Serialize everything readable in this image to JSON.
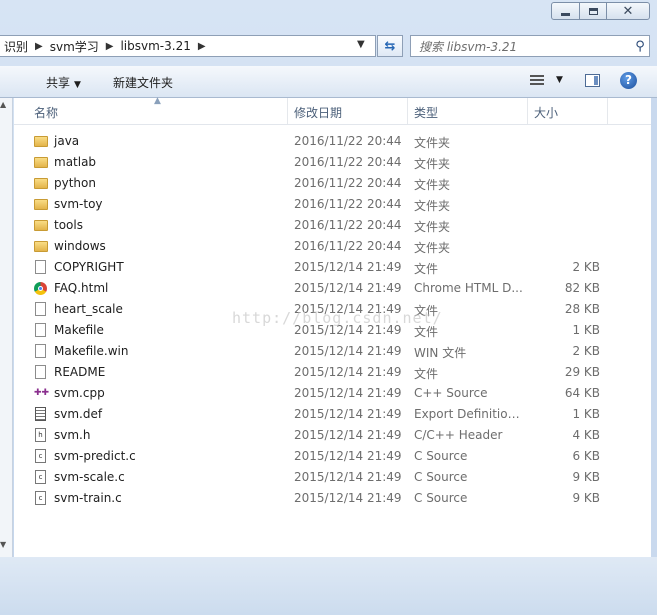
{
  "window": {
    "controls": {
      "minimize": "minimize-icon",
      "maximize": "maximize-icon",
      "close": "close-icon"
    }
  },
  "address": {
    "breadcrumbs": [
      "识别",
      "svm学习",
      "libsvm-3.21"
    ]
  },
  "search": {
    "placeholder": "搜索 libsvm-3.21"
  },
  "toolbar": {
    "share_label": "共享",
    "new_folder_label": "新建文件夹"
  },
  "columns": {
    "name": "名称",
    "date": "修改日期",
    "type": "类型",
    "size": "大小"
  },
  "files": [
    {
      "name": "java",
      "date": "2016/11/22 20:44",
      "type": "文件夹",
      "size": "",
      "icon": "folder-icon"
    },
    {
      "name": "matlab",
      "date": "2016/11/22 20:44",
      "type": "文件夹",
      "size": "",
      "icon": "folder-icon"
    },
    {
      "name": "python",
      "date": "2016/11/22 20:44",
      "type": "文件夹",
      "size": "",
      "icon": "folder-icon"
    },
    {
      "name": "svm-toy",
      "date": "2016/11/22 20:44",
      "type": "文件夹",
      "size": "",
      "icon": "folder-icon"
    },
    {
      "name": "tools",
      "date": "2016/11/22 20:44",
      "type": "文件夹",
      "size": "",
      "icon": "folder-icon"
    },
    {
      "name": "windows",
      "date": "2016/11/22 20:44",
      "type": "文件夹",
      "size": "",
      "icon": "folder-icon"
    },
    {
      "name": "COPYRIGHT",
      "date": "2015/12/14 21:49",
      "type": "文件",
      "size": "2 KB",
      "icon": "file-icon"
    },
    {
      "name": "FAQ.html",
      "date": "2015/12/14 21:49",
      "type": "Chrome HTML D...",
      "size": "82 KB",
      "icon": "chrome-icon"
    },
    {
      "name": "heart_scale",
      "date": "2015/12/14 21:49",
      "type": "文件",
      "size": "28 KB",
      "icon": "file-icon"
    },
    {
      "name": "Makefile",
      "date": "2015/12/14 21:49",
      "type": "文件",
      "size": "1 KB",
      "icon": "file-icon"
    },
    {
      "name": "Makefile.win",
      "date": "2015/12/14 21:49",
      "type": "WIN 文件",
      "size": "2 KB",
      "icon": "file-icon"
    },
    {
      "name": "README",
      "date": "2015/12/14 21:49",
      "type": "文件",
      "size": "29 KB",
      "icon": "file-icon"
    },
    {
      "name": "svm.cpp",
      "date": "2015/12/14 21:49",
      "type": "C++ Source",
      "size": "64 KB",
      "icon": "cpp-icon"
    },
    {
      "name": "svm.def",
      "date": "2015/12/14 21:49",
      "type": "Export Definition...",
      "size": "1 KB",
      "icon": "def-icon"
    },
    {
      "name": "svm.h",
      "date": "2015/12/14 21:49",
      "type": "C/C++ Header",
      "size": "4 KB",
      "icon": "header-icon"
    },
    {
      "name": "svm-predict.c",
      "date": "2015/12/14 21:49",
      "type": "C Source",
      "size": "6 KB",
      "icon": "c-icon"
    },
    {
      "name": "svm-scale.c",
      "date": "2015/12/14 21:49",
      "type": "C Source",
      "size": "9 KB",
      "icon": "c-icon"
    },
    {
      "name": "svm-train.c",
      "date": "2015/12/14 21:49",
      "type": "C Source",
      "size": "9 KB",
      "icon": "c-icon"
    }
  ],
  "watermark": "http://blog.csdn.net/"
}
